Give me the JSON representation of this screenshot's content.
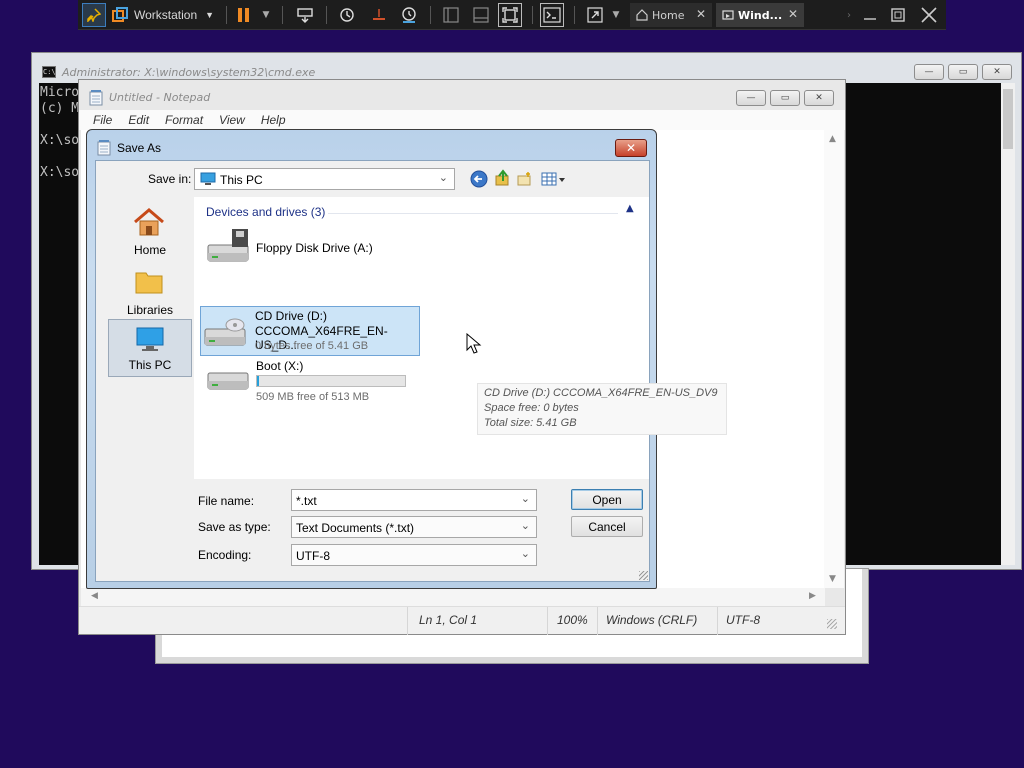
{
  "vm_toolbar": {
    "workstation_label": "Workstation",
    "tabs": [
      {
        "label": "Home"
      },
      {
        "label": "Wind..."
      }
    ]
  },
  "cmd": {
    "title": "Administrator: X:\\windows\\system32\\cmd.exe",
    "lines": [
      "Micro",
      "(c) M",
      "",
      "X:\\so",
      "",
      "X:\\so"
    ]
  },
  "notepad": {
    "title": "Untitled - Notepad",
    "menu": [
      "File",
      "Edit",
      "Format",
      "View",
      "Help"
    ],
    "status": {
      "position": "Ln 1, Col 1",
      "zoom": "100%",
      "line_ending": "Windows (CRLF)",
      "encoding": "UTF-8"
    }
  },
  "save_as": {
    "title": "Save As",
    "close_glyph": "✕",
    "save_in_label": "Save in:",
    "save_in_value": "This PC",
    "places": [
      {
        "label": "Home"
      },
      {
        "label": "Libraries"
      },
      {
        "label": "This PC"
      }
    ],
    "group_header": "Devices and drives (3)",
    "drives": [
      {
        "name": "Floppy Disk Drive (A:)"
      },
      {
        "name": "CD Drive (D:)",
        "subtitle": "CCCOMA_X64FRE_EN-US_D...",
        "free": "0 bytes free of 5.41 GB"
      },
      {
        "name": "Boot (X:)",
        "free": "509 MB free of 513 MB"
      }
    ],
    "tooltip": {
      "line1": "CD Drive (D:) CCCOMA_X64FRE_EN-US_DV9",
      "line2": "Space free: 0 bytes",
      "line3": "Total size: 5.41 GB"
    },
    "file_name_label": "File name:",
    "file_name_value": "*.txt",
    "save_type_label": "Save as type:",
    "save_type_value": "Text Documents (*.txt)",
    "encoding_label": "Encoding:",
    "encoding_value": "UTF-8",
    "open_button": "Open",
    "cancel_button": "Cancel"
  }
}
